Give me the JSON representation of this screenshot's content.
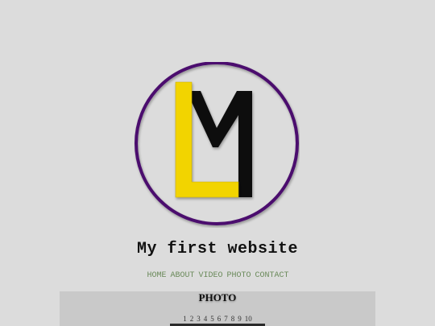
{
  "header": {
    "site_title": "My first website"
  },
  "logo": {
    "ring_color": "#4b0f6e",
    "l_color": "#f2d400",
    "m_color": "#111111"
  },
  "nav": {
    "items": [
      {
        "label": "HOME"
      },
      {
        "label": "ABOUT"
      },
      {
        "label": "VIDEO"
      },
      {
        "label": "PHOTO"
      },
      {
        "label": "CONTACT"
      }
    ],
    "link_color": "#6a8a5a"
  },
  "main": {
    "section_title": "PHOTO",
    "pages": [
      "1",
      "2",
      "3",
      "4",
      "5",
      "6",
      "7",
      "8",
      "9",
      "10"
    ]
  }
}
